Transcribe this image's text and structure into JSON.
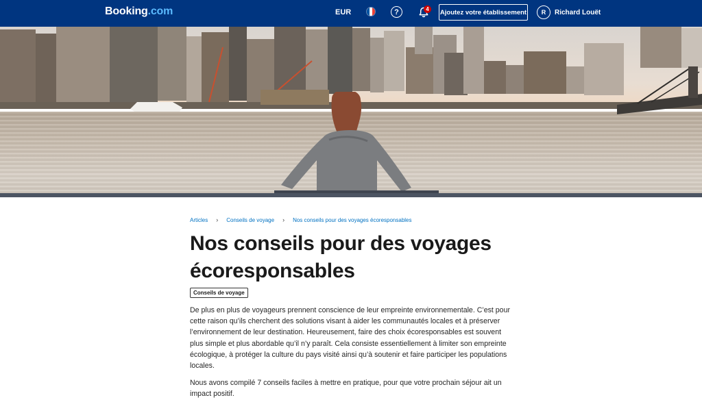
{
  "header": {
    "logo_main": "Booking",
    "logo_suffix": ".com",
    "currency": "EUR",
    "help_icon_glyph": "?",
    "notification_count": "4",
    "add_property_label": "Ajoutez votre établissement",
    "user_initial": "R",
    "user_name": "Richard Louët",
    "colors": {
      "background": "#003580",
      "logo_accent": "#5bbaff",
      "badge": "#cc0000"
    },
    "icons": [
      "france-flag-icon",
      "help-icon",
      "bell-icon"
    ]
  },
  "breadcrumb": {
    "items": [
      "Articles",
      "Conseils de voyage",
      "Nos conseils pour des voyages écoresponsables"
    ],
    "separator": "›"
  },
  "article": {
    "title": "Nos conseils pour des voyages écoresponsables",
    "category": "Conseils de voyage",
    "paragraphs": [
      "De plus en plus de voyageurs prennent conscience de leur empreinte environnementale. C’est pour cette raison qu’ils cherchent des solutions visant à aider les communautés locales et à préserver l’environnement de leur destination. Heureusement, faire des choix écoresponsables est souvent plus simple et plus abordable qu’il n’y paraît. Cela consiste essentiellement à limiter son empreinte écologique, à protéger la culture du pays visité ainsi qu’à soutenir et faire participer les populations locales.",
      "Nous avons compilé 7 conseils faciles à mettre en pratique, pour que votre prochain séjour ait un impact positif."
    ]
  },
  "colors": {
    "link": "#0071c2",
    "text": "#1a1a1a"
  }
}
